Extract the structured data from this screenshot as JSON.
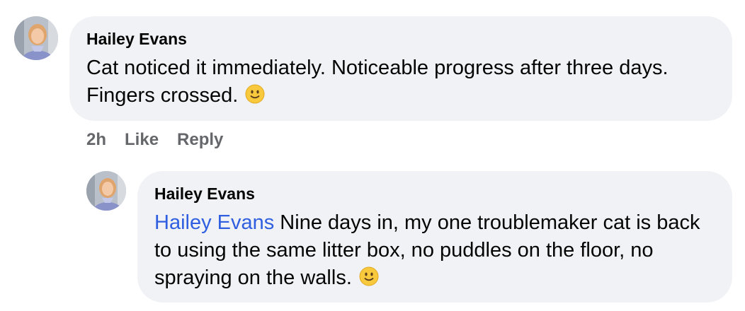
{
  "comment": {
    "author": "Hailey Evans",
    "text": "Cat noticed it immediately. Noticeable progress after three days. Fingers crossed.",
    "emoji_icon": "slightly-smiling-face",
    "actions": {
      "time": "2h",
      "like_label": "Like",
      "reply_label": "Reply"
    }
  },
  "reply": {
    "author": "Hailey Evans",
    "mention": "Hailey Evans",
    "text": " Nine days in, my one troublemaker cat is back to using the same litter box, no puddles on the floor, no spraying on the walls.",
    "emoji_icon": "slightly-smiling-face"
  },
  "colors": {
    "bubble_background": "#f0f2f5",
    "mention": "#2f5fe0",
    "action_text": "#65676b"
  }
}
